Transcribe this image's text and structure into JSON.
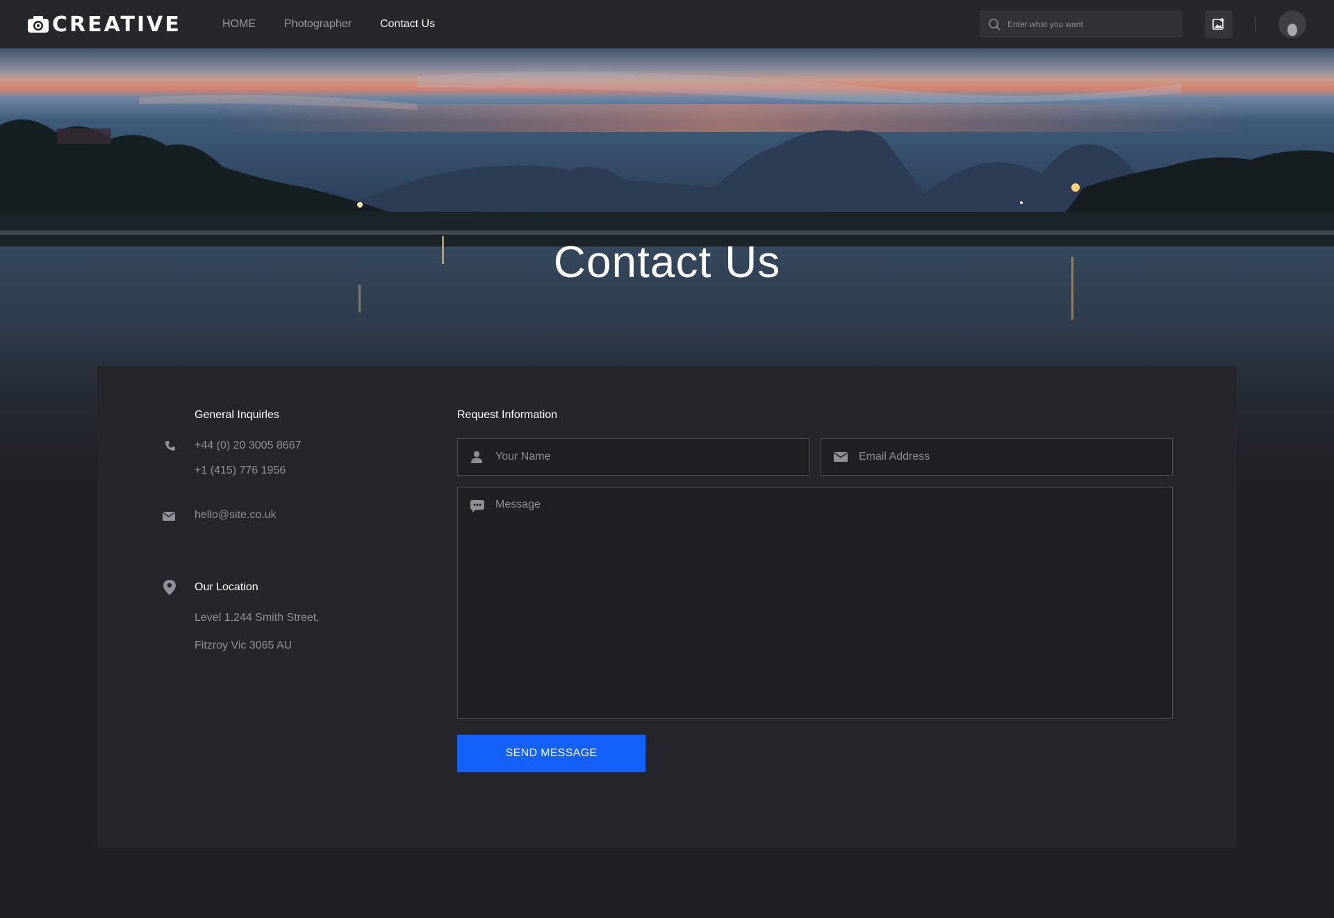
{
  "brand": {
    "logo_text": "CREATIVE",
    "logo_icon": "camera-icon"
  },
  "nav": {
    "links": [
      {
        "label": "HOME",
        "active": false
      },
      {
        "label": "Photographer",
        "active": false
      },
      {
        "label": "Contact Us",
        "active": true
      }
    ],
    "search_placeholder": "Enter what you want",
    "upload_icon": "image-add-icon",
    "avatar_icon": "avatar"
  },
  "hero": {
    "title": "Contact Us"
  },
  "contact": {
    "general_heading": "General Inquirles",
    "phones": [
      "+44 (0) 20 3005 8667",
      "+1 (415) 776 1956"
    ],
    "email": "hello@site.co.uk",
    "location_heading": "Our Location",
    "address_lines": [
      "Level 1,244 Smith Street,",
      "Fitzroy Vic 3065 AU"
    ]
  },
  "form": {
    "heading": "Request Information",
    "name_placeholder": "Your Name",
    "email_placeholder": "Email Address",
    "message_placeholder": "Message",
    "submit_label": "SEND MESSAGE"
  },
  "colors": {
    "nav_bg": "#25272c",
    "page_bg": "#1f2025",
    "card_bg": "#25262b",
    "accent": "#1360fb",
    "muted_text": "#8f9198"
  }
}
